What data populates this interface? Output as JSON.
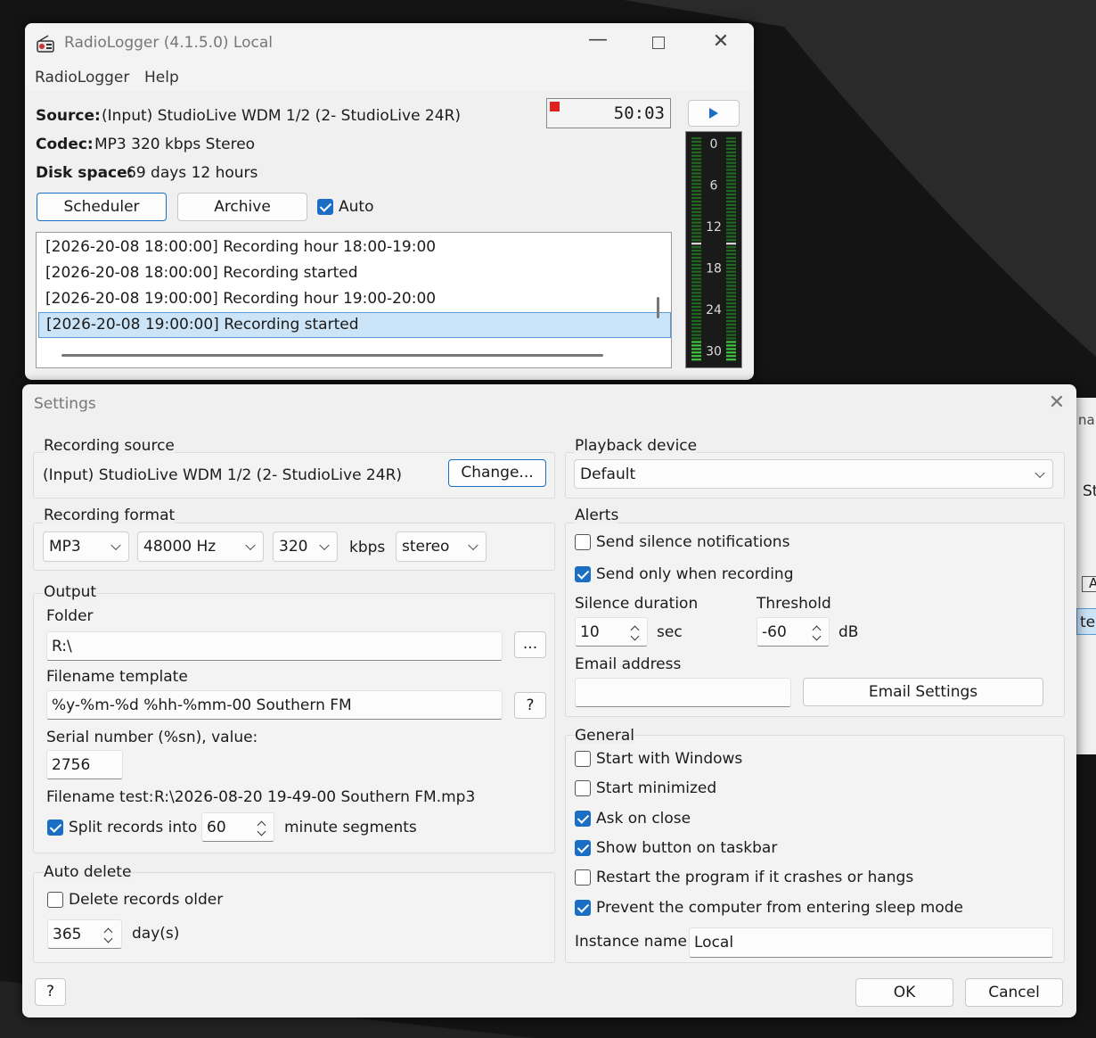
{
  "main_window": {
    "title": "RadioLogger (4.1.5.0) Local",
    "menu": [
      "RadioLogger",
      "Help"
    ],
    "source_label": "Source:",
    "source_value": "(Input) StudioLive WDM 1/2 (2- StudioLive 24R)",
    "codec_label": "Codec:",
    "codec_value": "MP3 320 kbps Stereo",
    "disk_label": "Disk space:",
    "disk_value": "69 days 12 hours",
    "timer": "50:03",
    "scheduler_label": "Scheduler",
    "archive_label": "Archive",
    "auto_label": "Auto",
    "auto_checked": true,
    "log": [
      "[2026-20-08 18:00:00] Recording hour 18:00-19:00",
      "[2026-20-08 18:00:00] Recording started",
      "[2026-20-08 19:00:00] Recording hour 19:00-20:00",
      "[2026-20-08 19:00:00] Recording started"
    ],
    "selected_log_index": 3,
    "meter_scale": [
      "0",
      "6",
      "12",
      "18",
      "24",
      "30"
    ],
    "meter_color": "#3ec43e",
    "recording_indicator_color": "#e0201c"
  },
  "settings": {
    "title": "Settings",
    "recording_source": {
      "title": "Recording source",
      "value": "(Input) StudioLive WDM 1/2 (2- StudioLive 24R)",
      "change_label": "Change..."
    },
    "playback": {
      "title": "Playback device",
      "value": "Default"
    },
    "format": {
      "title": "Recording format",
      "codec": "MP3",
      "rate": "48000 Hz",
      "bitrate": "320",
      "kbps_label": "kbps",
      "channels": "stereo"
    },
    "alerts": {
      "title": "Alerts",
      "silence_notif_label": "Send silence notifications",
      "silence_notif_checked": false,
      "only_recording_label": "Send only when recording",
      "only_recording_checked": true,
      "duration_label": "Silence duration",
      "duration_value": "10",
      "duration_unit": "sec",
      "threshold_label": "Threshold",
      "threshold_value": "-60",
      "threshold_unit": "dB",
      "email_label": "Email address",
      "email_value": "",
      "email_settings_label": "Email Settings"
    },
    "output": {
      "title": "Output",
      "folder_label": "Folder",
      "folder_value": "R:\\",
      "browse_label": "...",
      "template_label": "Filename template",
      "template_value": "%y-%m-%d %hh-%mm-00 Southern FM",
      "template_help_label": "?",
      "serial_label": "Serial number (%sn), value:",
      "serial_value": "2756",
      "test_label": "Filename test:",
      "test_value": "R:\\2026-08-20 19-49-00 Southern FM.mp3",
      "split_label": "Split records into",
      "split_checked": true,
      "split_value": "60",
      "split_unit": "minute segments"
    },
    "general": {
      "title": "General",
      "options": [
        {
          "label": "Start with Windows",
          "checked": false
        },
        {
          "label": "Start minimized",
          "checked": false
        },
        {
          "label": "Ask on close",
          "checked": true
        },
        {
          "label": "Show button on taskbar",
          "checked": true
        },
        {
          "label": "Restart the program if it crashes or hangs",
          "checked": false
        },
        {
          "label": "Prevent the computer from entering sleep mode",
          "checked": true
        }
      ],
      "instance_label": "Instance name",
      "instance_value": "Local"
    },
    "auto_delete": {
      "title": "Auto delete",
      "delete_label": "Delete records older",
      "delete_checked": false,
      "days_value": "365",
      "days_unit": "day(s)"
    },
    "help_label": "?",
    "ok_label": "OK",
    "cancel_label": "Cancel"
  },
  "background_window": {
    "fragments": [
      "nar",
      "St",
      "A",
      "tec"
    ]
  }
}
